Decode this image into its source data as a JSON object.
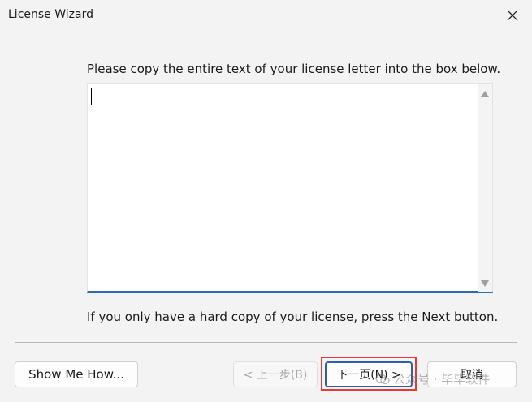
{
  "window": {
    "title": "License Wizard"
  },
  "instruction": "Please copy the entire text of your license letter into the box below.",
  "license_text": {
    "value": ""
  },
  "note": "If you only have a hard copy of your license, press the Next button.",
  "buttons": {
    "show_me_how": "Show Me How...",
    "back": "< 上一步(B)",
    "next": "下一页(N) >",
    "cancel": "取消"
  },
  "watermark": "公众号 · 毕毕软件",
  "colors": {
    "highlight": "#e53935",
    "focus_border": "#2f5fa8",
    "textbox_underline": "#2b6cb0"
  },
  "icons": {
    "close": "close-icon",
    "scroll_up": "scroll-up-arrow-icon",
    "scroll_down": "scroll-down-arrow-icon"
  }
}
